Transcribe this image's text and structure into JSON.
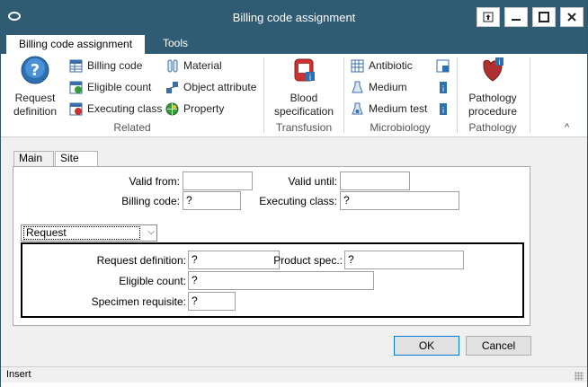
{
  "window": {
    "title": "Billing code assignment"
  },
  "ribbon": {
    "tabs": [
      "Billing code assignment",
      "Tools"
    ],
    "buttons": {
      "request_definition": "Request\ndefinition",
      "billing_code": "Billing code",
      "eligible_count": "Eligible count",
      "executing_class": "Executing class",
      "material": "Material",
      "object_attribute": "Object attribute",
      "property": "Property",
      "blood_specification": "Blood\nspecification",
      "antibiotic": "Antibiotic",
      "medium": "Medium",
      "medium_test": "Medium test",
      "pathology_procedure": "Pathology\nprocedure"
    },
    "groups": [
      "Related",
      "Transfusion",
      "Microbiology",
      "Pathology"
    ]
  },
  "tabs": [
    "Main",
    "Site attr."
  ],
  "form": {
    "valid_from_label": "Valid from:",
    "valid_from": "",
    "valid_until_label": "Valid until:",
    "valid_until": "",
    "billing_code_label": "Billing code:",
    "billing_code": "?",
    "executing_class_label": "Executing class:",
    "executing_class": "?",
    "request_combo": "Request",
    "request_definition_label": "Request definition:",
    "request_definition": "?",
    "product_spec_label": "Product spec.:",
    "product_spec": "?",
    "eligible_count_label": "Eligible count:",
    "eligible_count": "?",
    "specimen_requisite_label": "Specimen requisite:",
    "specimen_requisite": "?"
  },
  "buttons": {
    "ok": "OK",
    "cancel": "Cancel"
  },
  "status": {
    "mode": "Insert"
  },
  "colors": {
    "titlebar": "#2f5b73",
    "accent": "#0078d7"
  }
}
